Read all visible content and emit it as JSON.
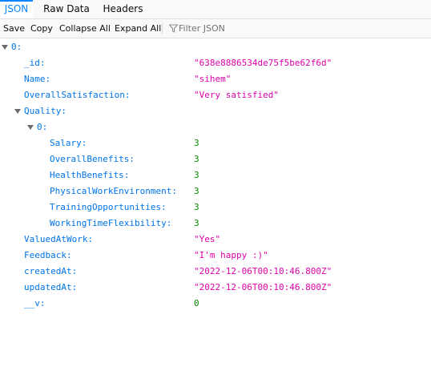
{
  "tabs": [
    {
      "label": "JSON",
      "selected": true
    },
    {
      "label": "Raw Data",
      "selected": false
    },
    {
      "label": "Headers",
      "selected": false
    }
  ],
  "toolbar": {
    "save": "Save",
    "copy": "Copy",
    "collapse_all": "Collapse All",
    "expand_all": "Expand All",
    "filter_placeholder": "Filter JSON",
    "filter_icon": "filter-icon"
  },
  "colors": {
    "key": "#0074e8",
    "string": "#dd00a9",
    "number": "#058b00",
    "accent": "#0a84ff"
  },
  "tree": {
    "root_key": "0:",
    "id_key": "_id:",
    "id_val": "\"638e8886534de75f5be62f6d\"",
    "name_key": "Name:",
    "name_val": "\"sihem\"",
    "overall_key": "OverallSatisfaction:",
    "overall_val": "\"Very satisfied\"",
    "quality_key": "Quality:",
    "quality_item_key": "0:",
    "salary_key": "Salary:",
    "salary_val": "3",
    "ob_key": "OverallBenefits:",
    "ob_val": "3",
    "hb_key": "HealthBenefits:",
    "hb_val": "3",
    "pwe_key": "PhysicalWorkEnvironment:",
    "pwe_val": "3",
    "to_key": "TrainingOpportunities:",
    "to_val": "3",
    "wtf_key": "WorkingTimeFlexibility:",
    "wtf_val": "3",
    "vaw_key": "ValuedAtWork:",
    "vaw_val": "\"Yes\"",
    "fb_key": "Feedback:",
    "fb_val": "\"I'm happy :)\"",
    "ca_key": "createdAt:",
    "ca_val": "\"2022-12-06T00:10:46.800Z\"",
    "ua_key": "updatedAt:",
    "ua_val": "\"2022-12-06T00:10:46.800Z\"",
    "v_key": "__v:",
    "v_val": "0"
  }
}
